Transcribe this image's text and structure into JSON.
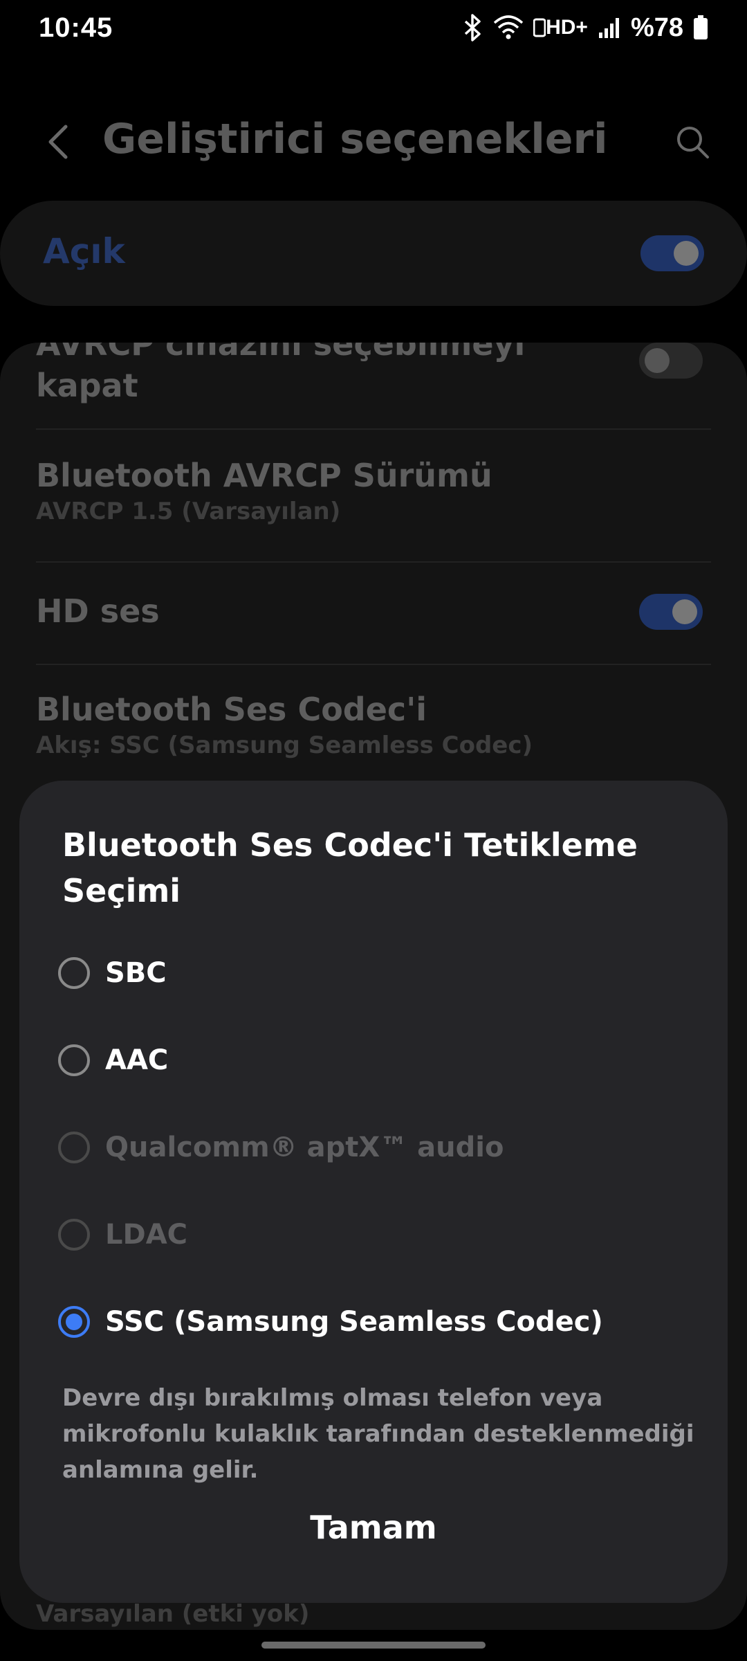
{
  "status_bar": {
    "time": "10:45",
    "network_label": "HD+",
    "battery_text": "%78"
  },
  "header": {
    "title": "Geliştirici seçenekleri"
  },
  "master_switch": {
    "label": "Açık",
    "state": "on"
  },
  "settings": {
    "items": [
      {
        "title_partial": "AVRCP cihazını seçebilmeyi",
        "title": "kapat",
        "toggle": "off"
      },
      {
        "title": "Bluetooth AVRCP Sürümü",
        "subtitle": "AVRCP 1.5 (Varsayılan)"
      },
      {
        "title": "HD ses",
        "toggle": "on"
      },
      {
        "title": "Bluetooth Ses Codec'i",
        "subtitle": "Akış: SSC (Samsung Seamless Codec)"
      }
    ],
    "bottom_partial": "Varsayılan (etki yok)"
  },
  "dialog": {
    "title": "Bluetooth Ses Codec'i Tetikleme Seçimi",
    "options": [
      {
        "label": "SBC",
        "state": "enabled"
      },
      {
        "label": "AAC",
        "state": "enabled"
      },
      {
        "label": "Qualcomm® aptX™ audio",
        "state": "disabled"
      },
      {
        "label": "LDAC",
        "state": "disabled"
      },
      {
        "label": "SSC (Samsung Seamless Codec)",
        "state": "selected"
      }
    ],
    "note": "Devre dışı bırakılmış olması telefon veya mikrofonlu kulaklık tarafından desteklenmediği anlamına gelir.",
    "ok_label": "Tamam"
  },
  "colors": {
    "background": "#000000",
    "card": "#141414",
    "dialog": "#252528",
    "accent": "#3d7cf5",
    "toggle_on": "#1e3468"
  }
}
